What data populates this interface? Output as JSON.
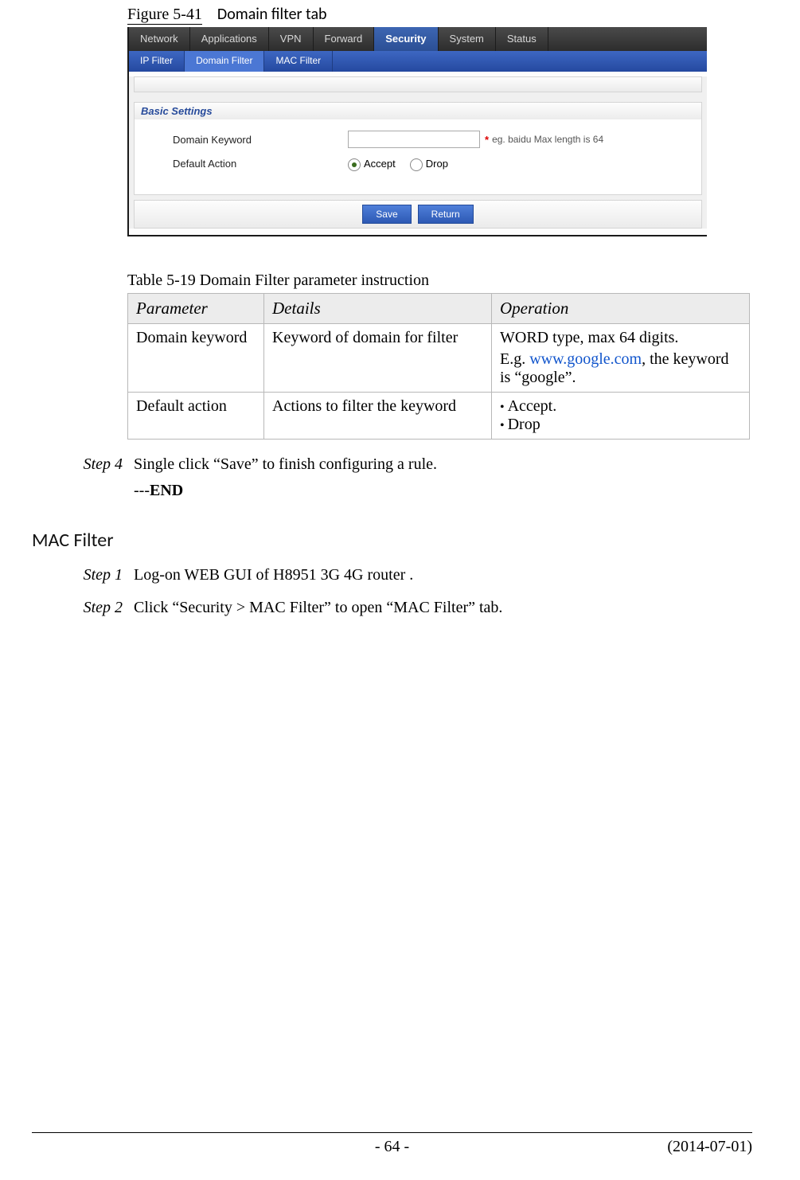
{
  "figure": {
    "number": "Figure 5-41",
    "title": "Domain filter tab"
  },
  "screenshot": {
    "main_tabs": [
      "Network",
      "Applications",
      "VPN",
      "Forward",
      "Security",
      "System",
      "Status"
    ],
    "main_active_index": 4,
    "sub_tabs": [
      "IP Filter",
      "Domain Filter",
      "MAC Filter"
    ],
    "sub_active_index": 1,
    "panel_title": "Basic Settings",
    "fields": {
      "domain_keyword_label": "Domain Keyword",
      "domain_keyword_value": "",
      "domain_keyword_hint": "eg. baidu Max length is 64",
      "default_action_label": "Default Action",
      "accept_label": "Accept",
      "drop_label": "Drop",
      "selected_action": "Accept"
    },
    "buttons": {
      "save": "Save",
      "return": "Return"
    }
  },
  "table": {
    "caption": "Table 5-19  Domain Filter parameter instruction",
    "headers": [
      "Parameter",
      "Details",
      "Operation"
    ],
    "rows": [
      {
        "parameter": "Domain keyword",
        "details": "Keyword of domain for filter",
        "operation_line1": "WORD type, max 64 digits.",
        "operation_line2_pre": "E.g. ",
        "operation_link": "www.google.com",
        "operation_line2_post": ", the keyword is “google”."
      },
      {
        "parameter": "Default action",
        "details": "Actions to filter the keyword",
        "operation_bullets": [
          "Accept.",
          "Drop"
        ]
      }
    ]
  },
  "steps_after_table": {
    "step4_label": "Step 4",
    "step4_text": "Single click “Save” to finish configuring a rule.",
    "end": "---END"
  },
  "section_heading": "MAC Filter",
  "mac_steps": {
    "step1_label": "Step 1",
    "step1_text": "Log-on WEB GUI of H8951 3G 4G router .",
    "step2_label": "Step 2",
    "step2_text": "Click “Security > MAC Filter” to open “MAC Filter” tab."
  },
  "footer": {
    "page": "- 64 -",
    "date": "(2014-07-01)"
  }
}
